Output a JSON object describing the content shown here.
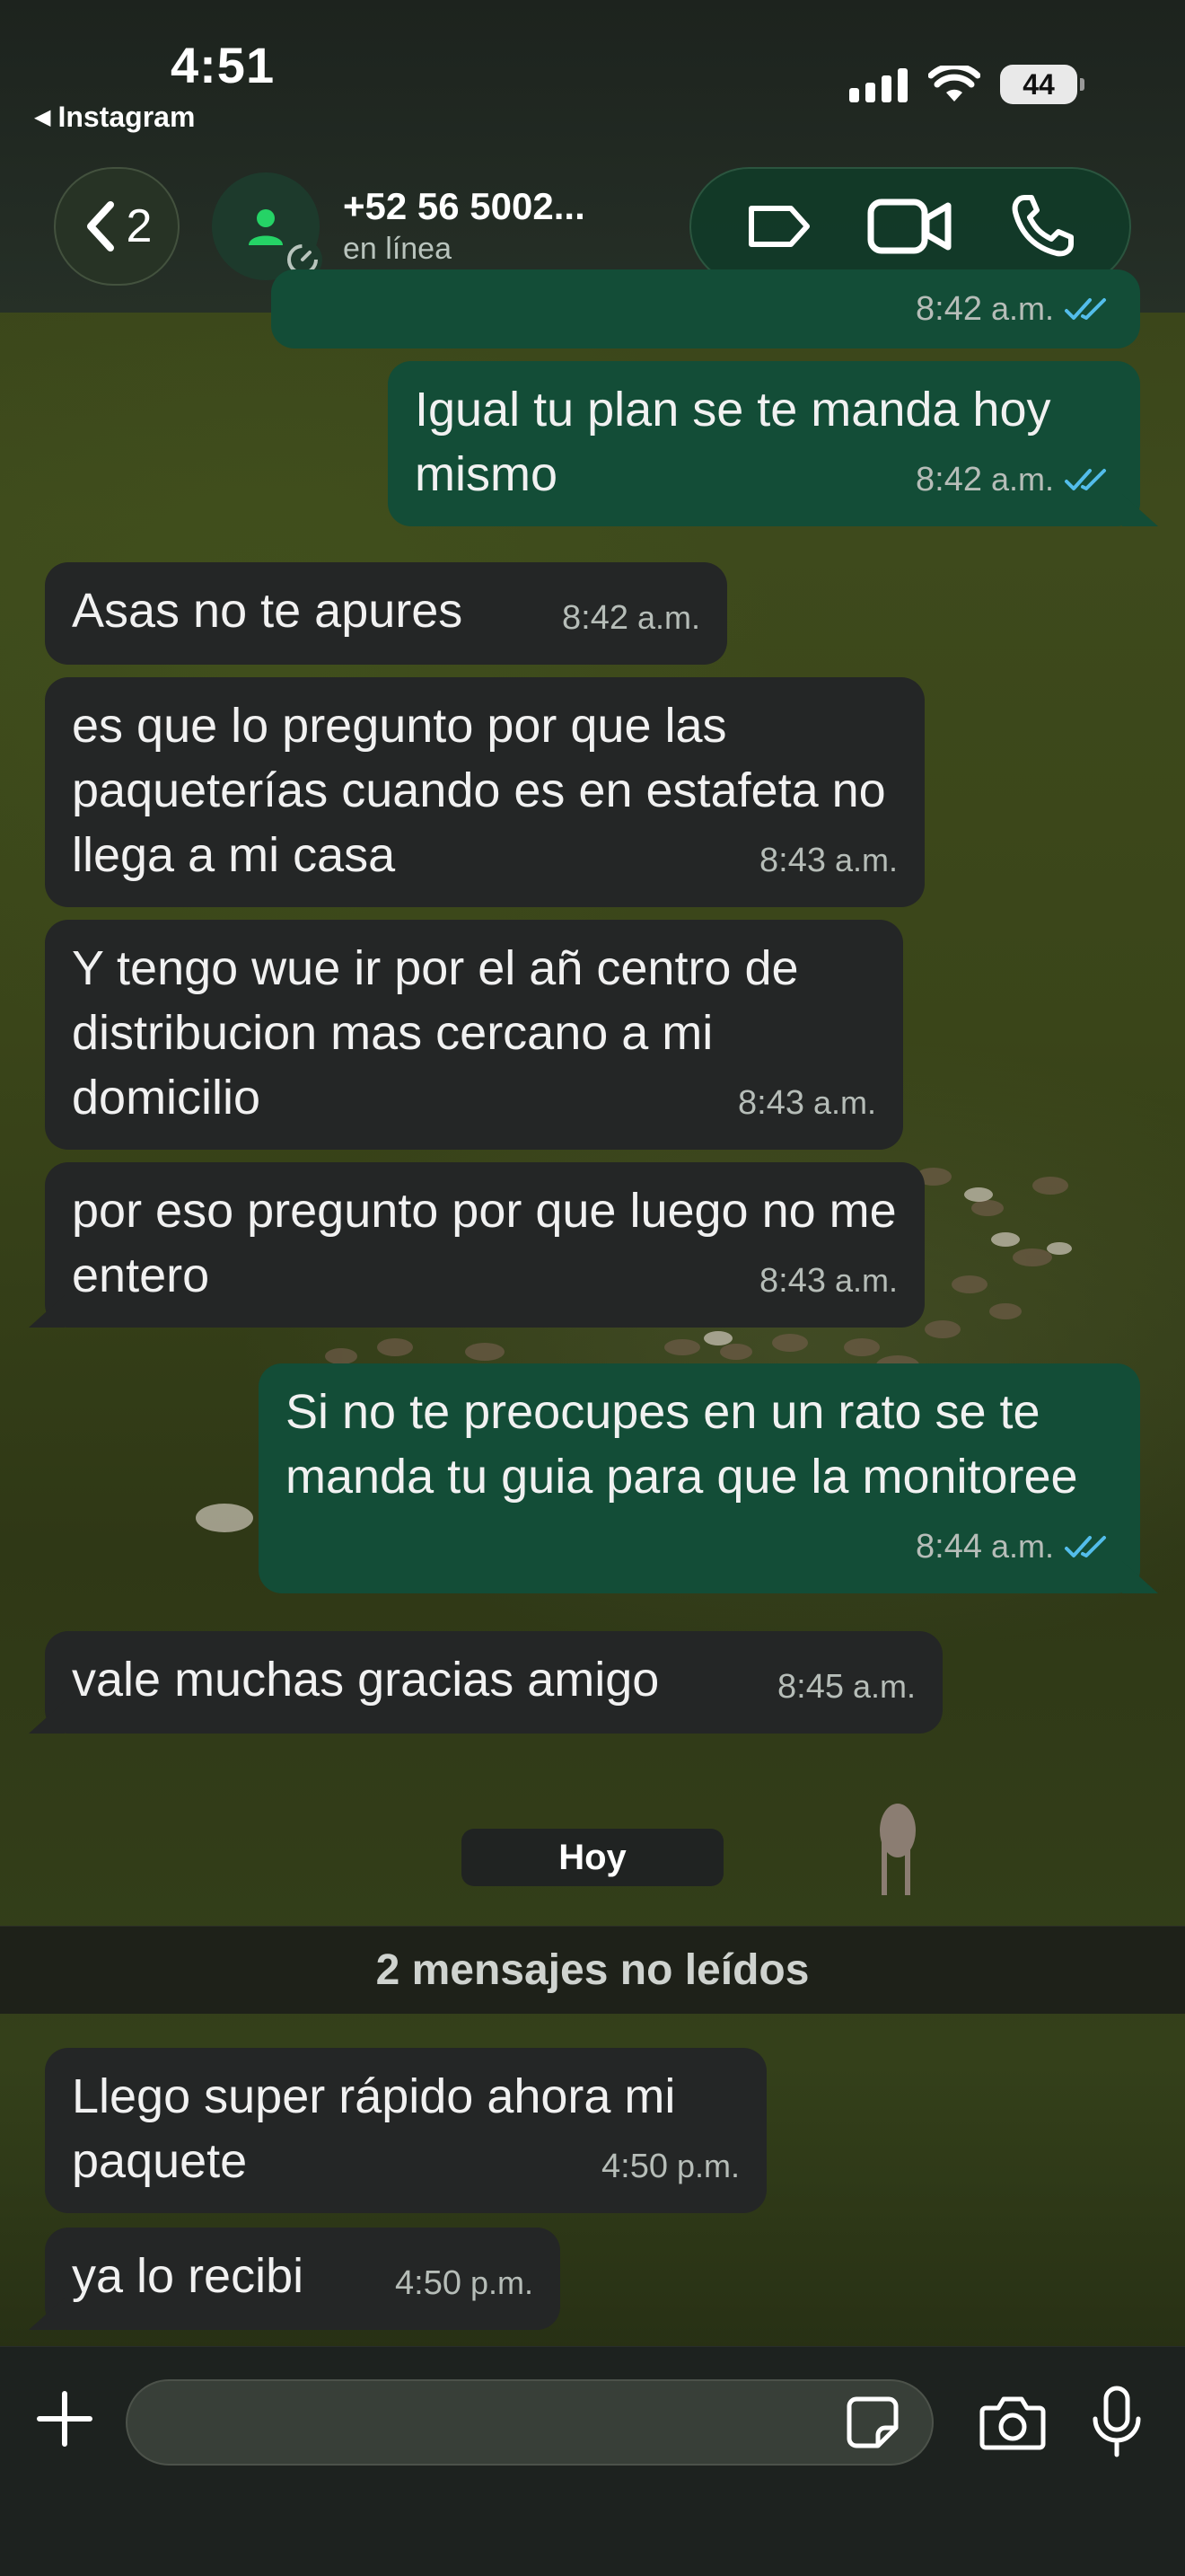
{
  "status_bar": {
    "time": "4:51",
    "back_app": "Instagram",
    "battery": "44"
  },
  "header": {
    "back_count": "2",
    "contact_name": "+52 56 5002...",
    "contact_status": "en línea"
  },
  "colors": {
    "incoming_bubble": "#242626",
    "outgoing_bubble": "#134d37",
    "read_ticks": "#53bdeb",
    "accent_green": "#25d366"
  },
  "messages": [
    {
      "dir": "out",
      "text": "",
      "time": "8:42",
      "ampm": "a.m.",
      "read": true
    },
    {
      "dir": "out",
      "text": "Igual tu plan se te manda hoy mismo",
      "time": "8:42",
      "ampm": "a.m.",
      "read": true
    },
    {
      "dir": "in",
      "text": "Asas no te apures",
      "time": "8:42",
      "ampm": "a.m."
    },
    {
      "dir": "in",
      "text": "es que lo pregunto por que las paqueterías cuando es en estafeta no llega a mi casa",
      "time": "8:43",
      "ampm": "a.m."
    },
    {
      "dir": "in",
      "text": "Y tengo wue ir por el añ centro de distribucion mas cercano a mi domicilio",
      "time": "8:43",
      "ampm": "a.m."
    },
    {
      "dir": "in",
      "text": "por eso pregunto por que luego no me entero",
      "time": "8:43",
      "ampm": "a.m."
    },
    {
      "dir": "out",
      "text": "Si no te preocupes en un rato se te manda tu guia para que la monitoree",
      "time": "8:44",
      "ampm": "a.m.",
      "read": true
    },
    {
      "dir": "in",
      "text": "vale muchas gracias amigo",
      "time": "8:45",
      "ampm": "a.m."
    },
    {
      "dir": "in",
      "text": "Llego super rápido ahora mi paquete",
      "time": "4:50",
      "ampm": "p.m."
    },
    {
      "dir": "in",
      "text": "ya lo recibi",
      "time": "4:50",
      "ampm": "p.m."
    }
  ],
  "day_separator": "Hoy",
  "unread_banner": "2 mensajes no leídos",
  "composer": {
    "value": "",
    "placeholder": ""
  },
  "icons": [
    "chevron-left-icon",
    "person-icon",
    "label-icon",
    "video-camera-icon",
    "phone-icon",
    "plus-icon",
    "sticker-icon",
    "camera-icon",
    "microphone-icon"
  ]
}
